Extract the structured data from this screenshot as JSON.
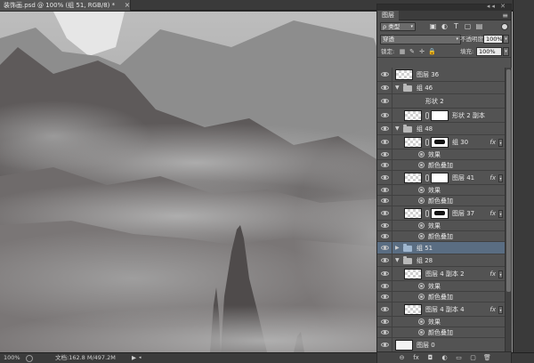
{
  "document": {
    "tab_title": "装饰画.psd @ 100% (组 51, RGB/8) *",
    "close": "×"
  },
  "status": {
    "zoom": "100%",
    "doc_info": "文档:162.8 M/497.2M",
    "arrow": "▶",
    "arrow2": "◂"
  },
  "panel": {
    "tab": "图层",
    "menu": "≡",
    "top_controls": "◂◂ ✕",
    "filter": {
      "label": "ρ 类型",
      "caret": "▾"
    },
    "filter_icons": [
      "pixel-filter-icon",
      "adjustment-filter-icon",
      "type-filter-icon",
      "shape-filter-icon",
      "smart-object-filter-icon"
    ],
    "blend_mode": "穿透",
    "opacity_label": "不透明度:",
    "opacity_value": "100%",
    "lock_label": "锁定:",
    "fill_label": "填充:",
    "fill_value": "100%",
    "caret": "▾"
  },
  "layers": [
    {
      "type": "layer",
      "indent": 0,
      "name": "图层 36",
      "thumb": "checker"
    },
    {
      "type": "group",
      "indent": 0,
      "name": "组 46",
      "expanded": true
    },
    {
      "type": "layer",
      "indent": 1,
      "name": "形状 2",
      "thumb": "none"
    },
    {
      "type": "layer",
      "indent": 1,
      "name": "形状 2 副本",
      "thumb": "checker",
      "mask": "white"
    },
    {
      "type": "group",
      "indent": 0,
      "name": "组 48",
      "expanded": true
    },
    {
      "type": "group-fx",
      "indent": 1,
      "name": "组 30",
      "thumb": "checker",
      "mask": "blot",
      "fx": "fx"
    },
    {
      "type": "effect",
      "indent": 2,
      "name": "效果"
    },
    {
      "type": "effect-item",
      "indent": 3,
      "name": "颜色叠加"
    },
    {
      "type": "layer-fx",
      "indent": 1,
      "name": "图层 41",
      "thumb": "checker",
      "mask": "white",
      "fx": "fx"
    },
    {
      "type": "effect",
      "indent": 2,
      "name": "效果"
    },
    {
      "type": "effect-item",
      "indent": 3,
      "name": "颜色叠加"
    },
    {
      "type": "layer-fx",
      "indent": 1,
      "name": "图层 37",
      "thumb": "checker",
      "mask": "blot",
      "fx": "fx"
    },
    {
      "type": "effect",
      "indent": 2,
      "name": "效果"
    },
    {
      "type": "effect-item",
      "indent": 3,
      "name": "颜色叠加"
    },
    {
      "type": "group",
      "indent": 0,
      "name": "组 51",
      "expanded": false,
      "selected": true
    },
    {
      "type": "group",
      "indent": 0,
      "name": "组 28",
      "expanded": true
    },
    {
      "type": "layer-fx",
      "indent": 1,
      "name": "图层 4 副本 2",
      "thumb": "checker",
      "fx": "fx"
    },
    {
      "type": "effect",
      "indent": 2,
      "name": "效果"
    },
    {
      "type": "effect-item",
      "indent": 3,
      "name": "颜色叠加"
    },
    {
      "type": "layer-fx",
      "indent": 1,
      "name": "图层 4 副本 4",
      "thumb": "checker",
      "fx": "fx"
    },
    {
      "type": "effect",
      "indent": 2,
      "name": "效果"
    },
    {
      "type": "effect-item",
      "indent": 3,
      "name": "颜色叠加"
    },
    {
      "type": "layer",
      "indent": 0,
      "name": "图层 0",
      "thumb": "white"
    }
  ],
  "footer_icons": [
    "link-icon",
    "fx-icon",
    "mask-icon",
    "adjustment-icon",
    "folder-icon",
    "new-layer-icon",
    "trash-icon"
  ],
  "footer_glyphs": [
    "⊖",
    "fx",
    "◘",
    "◐",
    "▭",
    "▢",
    "🗑"
  ],
  "colors": {
    "panel_bg": "#535353",
    "selected_row": "#5a6d82",
    "canvas_fog": "#9a9a9a"
  }
}
